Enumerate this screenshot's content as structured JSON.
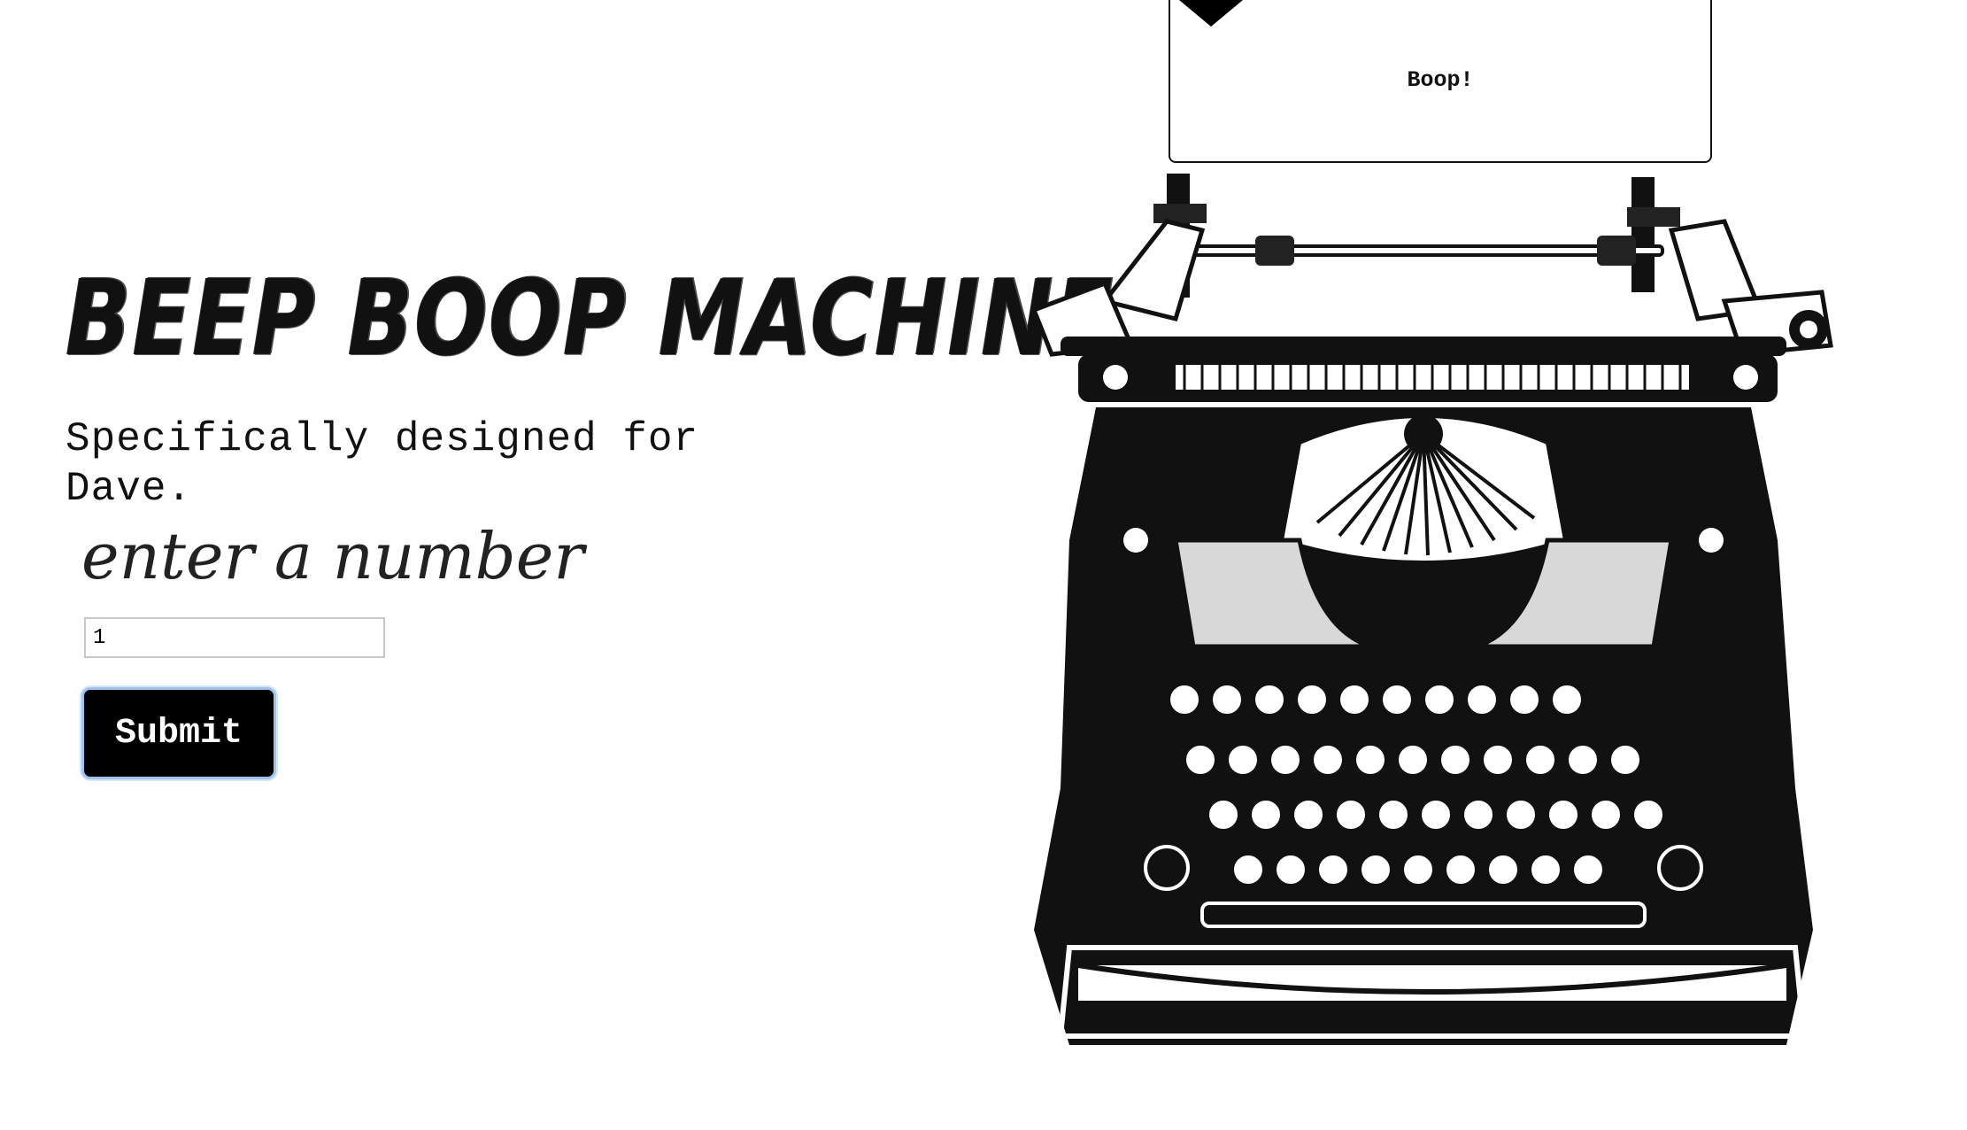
{
  "page": {
    "title": "BEEP BOOP MACHINE",
    "subtitle": "Specifically designed for Dave."
  },
  "form": {
    "label": "enter a number",
    "input_value": "1",
    "submit_label": "Submit"
  },
  "output": {
    "text": "Boop!"
  },
  "colors": {
    "background": "#ffffff",
    "ink": "#000000",
    "focus_ring": "#9cc4ef"
  },
  "icons": {
    "typewriter": "typewriter-illustration",
    "paper_marker": "triangle-down-icon"
  }
}
